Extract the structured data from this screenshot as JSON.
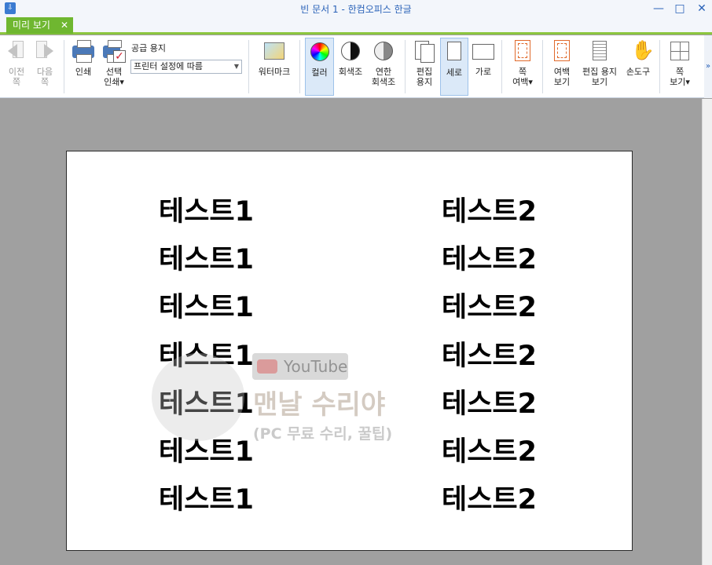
{
  "window": {
    "title": "빈 문서 1 - 한컴오피스 한글",
    "icon_name": "hwp-app-icon",
    "minimize": "—",
    "maximize": "□",
    "close": "✕"
  },
  "tab": {
    "label": "미리 보기",
    "close": "✕",
    "accent": "#6fb730"
  },
  "ribbon": {
    "prev_page": "이전\n쪽",
    "next_page": "다음\n쪽",
    "print": "인쇄",
    "select_print": "선택\n인쇄▾",
    "paper_label": "공급 용지",
    "paper_value": "프린터 설정에 따름",
    "watermark": "워터마크",
    "color": "컬러",
    "grayscale": "회색조",
    "light_grayscale": "연한\n회색조",
    "edit_paper": "편집\n용지",
    "portrait": "세로",
    "landscape": "가로",
    "page_margin": "쪽\n여백▾",
    "margin_view": "여백\n보기",
    "edit_paper_view": "편집 용지\n보기",
    "hand_tool": "손도구",
    "page_view": "쪽\n보기▾",
    "overflow": "»"
  },
  "document": {
    "left_column": [
      "테스트1",
      "테스트1",
      "테스트1",
      "테스트1",
      "테스트1",
      "테스트1",
      "테스트1"
    ],
    "right_column": [
      "테스트2",
      "테스트2",
      "테스트2",
      "테스트2",
      "테스트2",
      "테스트2",
      "테스트2"
    ]
  },
  "watermark": {
    "youtube": "YouTube",
    "channel": "맨날 수리야",
    "subtitle": "(PC 무료 수리, 꿀팁)"
  }
}
